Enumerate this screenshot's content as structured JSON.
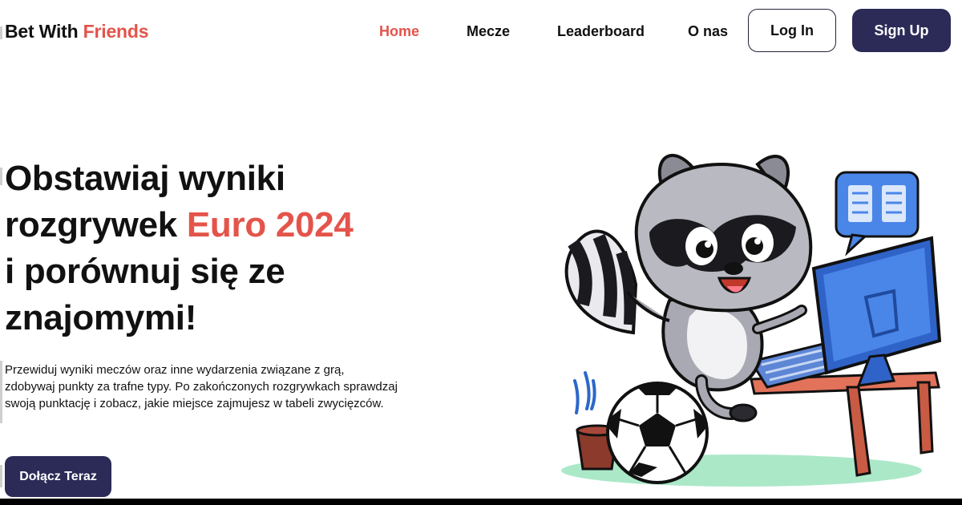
{
  "brand": {
    "part1": "Bet With",
    "part2": "Friends"
  },
  "nav": {
    "items": [
      {
        "label": "Home",
        "active": true
      },
      {
        "label": "Mecze",
        "active": false
      },
      {
        "label": "Leaderboard",
        "active": false
      },
      {
        "label": "O nas",
        "active": false
      }
    ],
    "login_label": "Log In",
    "signup_label": "Sign Up"
  },
  "hero": {
    "title_line1": "Obstawiaj wyniki",
    "title_line2_prefix": "rozgrywek",
    "title_line2_accent": "Euro 2024",
    "title_line3": "i porównuj się ze",
    "title_line4": "znajomymi!",
    "description": "Przewiduj wyniki meczów oraz inne wydarzenia związane z grą, zdobywaj punkty za trafne typy. Po zakończonych rozgrywkach sprawdzaj swoją punktację i zobacz, jakie miejsce zajmujesz w tabeli zwycięzców.",
    "cta_label": "Dołącz Teraz"
  },
  "colors": {
    "accent": "#e4544b",
    "primary": "#2c2a57",
    "text": "#111111",
    "background": "#ffffff"
  },
  "icons": {
    "illustration": "raccoon-at-computer-with-soccer-ball"
  }
}
